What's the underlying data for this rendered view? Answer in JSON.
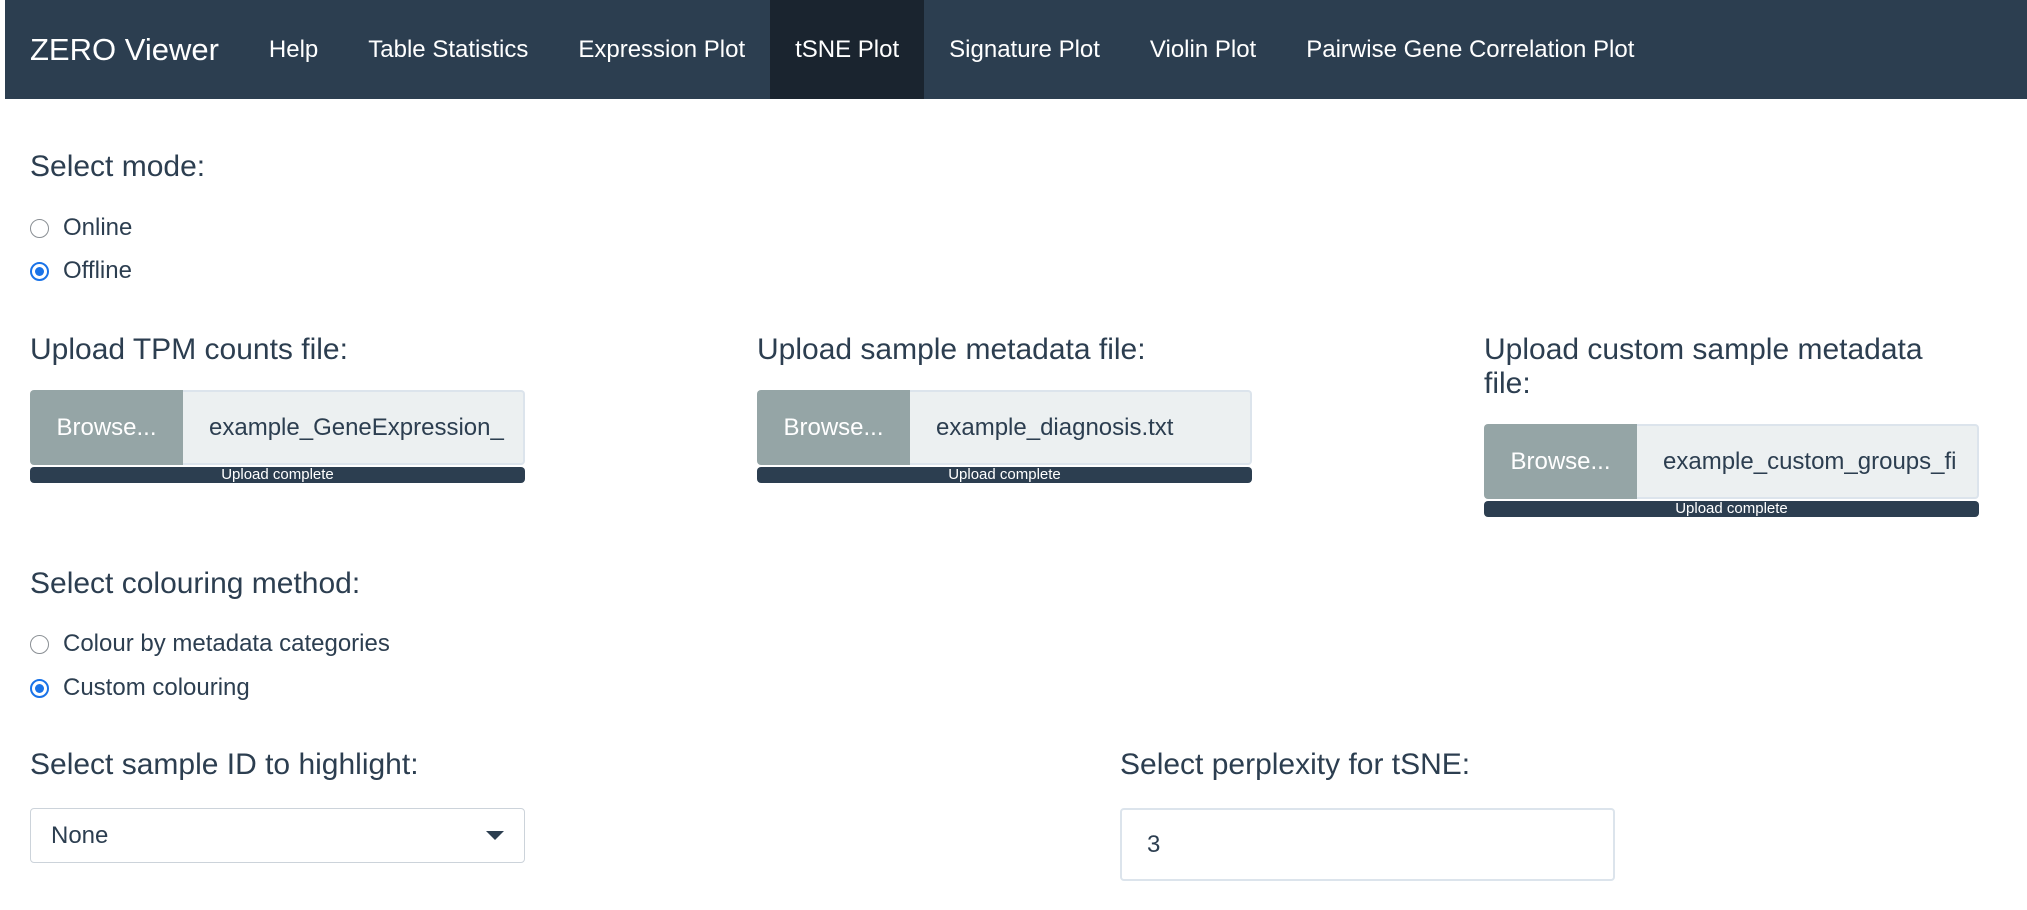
{
  "navbar": {
    "brand": "ZERO Viewer",
    "items": [
      {
        "label": "Help"
      },
      {
        "label": "Table Statistics"
      },
      {
        "label": "Expression Plot"
      },
      {
        "label": "tSNE Plot"
      },
      {
        "label": "Signature Plot"
      },
      {
        "label": "Violin Plot"
      },
      {
        "label": "Pairwise Gene Correlation Plot"
      }
    ],
    "active_tab": "tSNE Plot"
  },
  "mode": {
    "label": "Select mode:",
    "options": [
      {
        "label": "Online",
        "checked": false
      },
      {
        "label": "Offline",
        "checked": true
      }
    ]
  },
  "uploads": [
    {
      "label": "Upload TPM counts file:",
      "button": "Browse...",
      "file": "example_GeneExpression_",
      "status": "Upload complete"
    },
    {
      "label": "Upload sample metadata file:",
      "button": "Browse...",
      "file": "example_diagnosis.txt",
      "status": "Upload complete"
    },
    {
      "label_line1": "Upload custom sample metadata",
      "label_line2": "file:",
      "button": "Browse...",
      "file": "example_custom_groups_fi",
      "status": "Upload complete"
    }
  ],
  "colouring": {
    "label": "Select colouring method:",
    "options": [
      {
        "label": "Colour by metadata categories",
        "checked": false
      },
      {
        "label": "Custom colouring",
        "checked": true
      }
    ]
  },
  "highlight": {
    "label": "Select sample ID to highlight:",
    "selected": "None"
  },
  "perplexity": {
    "label": "Select perplexity for tSNE:",
    "value": "3"
  },
  "colors": {
    "navbar_bg": "#2c3e50",
    "active_tab_bg": "#1a242f",
    "browse_button_bg": "#95a5a6",
    "radio_checked": "#1a73e8"
  }
}
